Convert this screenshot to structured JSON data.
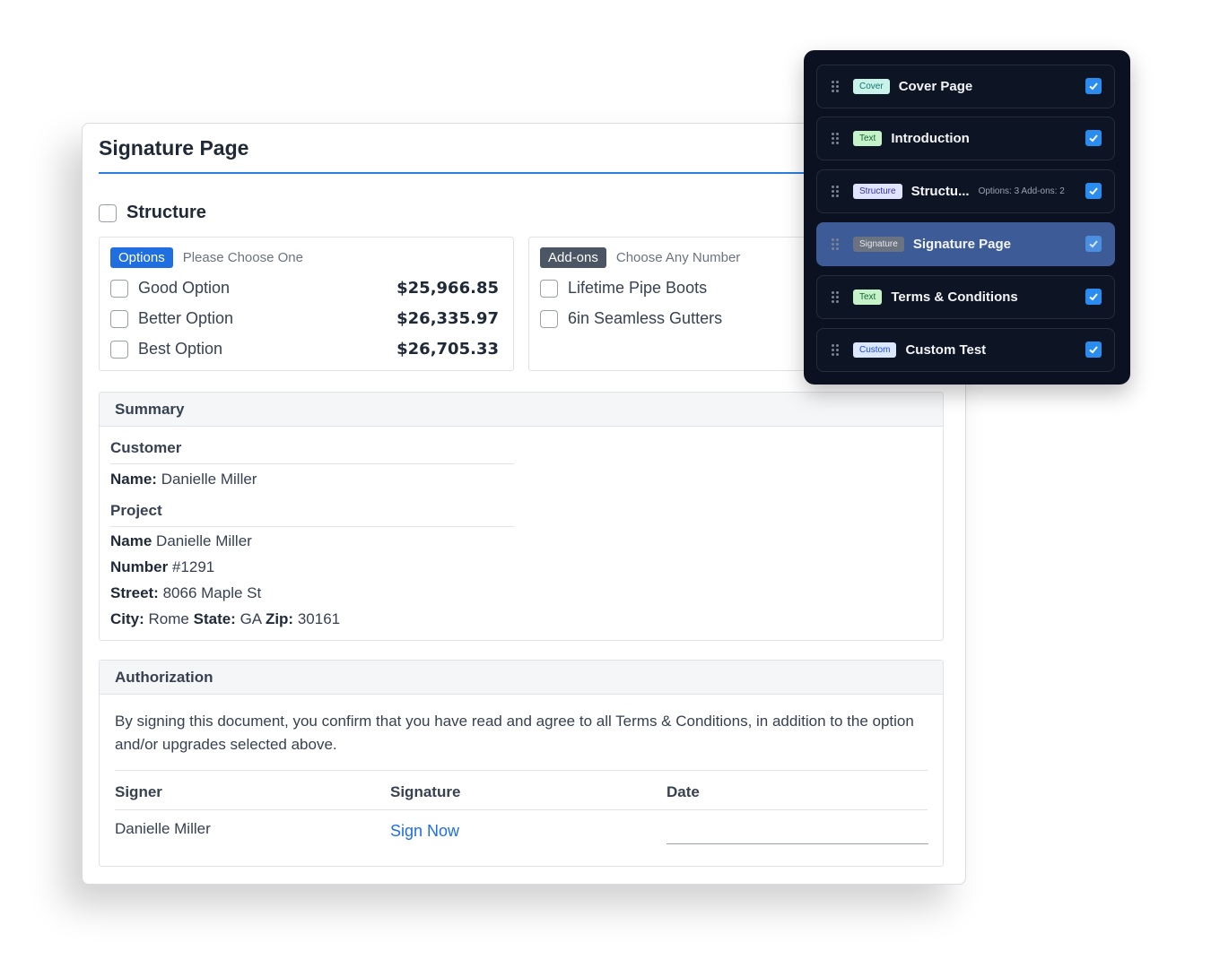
{
  "page": {
    "title": "Signature Page",
    "structure_label": "Structure"
  },
  "options": {
    "tag": "Options",
    "hint": "Please Choose One",
    "items": [
      {
        "label": "Good Option",
        "price": "$25,966.85"
      },
      {
        "label": "Better Option",
        "price": "$26,335.97"
      },
      {
        "label": "Best Option",
        "price": "$26,705.33"
      }
    ]
  },
  "addons": {
    "tag": "Add-ons",
    "hint": "Choose Any Number",
    "items": [
      {
        "label": "Lifetime Pipe Boots"
      },
      {
        "label": "6in Seamless Gutters"
      }
    ]
  },
  "summary": {
    "heading": "Summary",
    "customer_heading": "Customer",
    "customer_name_key": "Name:",
    "customer_name": "Danielle Miller",
    "project_heading": "Project",
    "project_name_key": "Name",
    "project_name": "Danielle Miller",
    "number_key": "Number",
    "number": "#1291",
    "street_key": "Street:",
    "street": "8066 Maple St",
    "city_key": "City:",
    "city": "Rome",
    "state_key": "State:",
    "state": "GA",
    "zip_key": "Zip:",
    "zip": "30161"
  },
  "authorization": {
    "heading": "Authorization",
    "text": "By signing this document, you confirm that you have read and agree to all Terms & Conditions, in addition to the option and/or upgrades selected above.",
    "col_signer": "Signer",
    "col_signature": "Signature",
    "col_date": "Date",
    "signer": "Danielle Miller",
    "sign_link": "Sign Now"
  },
  "sidebar": {
    "items": [
      {
        "badge": "Cover",
        "label": "Cover Page",
        "meta": "",
        "checked": true
      },
      {
        "badge": "Text",
        "label": "Introduction",
        "meta": "",
        "checked": true
      },
      {
        "badge": "Structure",
        "label": "Structu...",
        "meta": "Options: 3 Add-ons: 2",
        "checked": true
      },
      {
        "badge": "Signature",
        "label": "Signature Page",
        "meta": "",
        "checked": true,
        "active": true
      },
      {
        "badge": "Text",
        "label": "Terms & Conditions",
        "meta": "",
        "checked": true
      },
      {
        "badge": "Custom",
        "label": "Custom Test",
        "meta": "",
        "checked": true
      }
    ]
  },
  "colors": {
    "accent": "#1f6fe0",
    "panel_bg": "#0b1120",
    "active_item": "#3d5c97"
  }
}
